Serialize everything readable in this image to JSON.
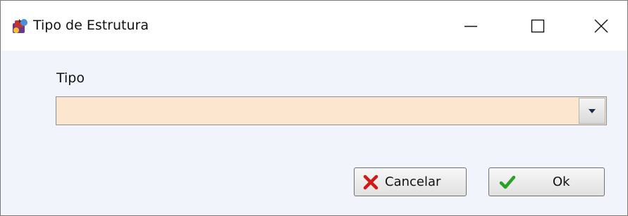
{
  "window": {
    "title": "Tipo de Estrutura",
    "app_icon": "application-icon",
    "controls": {
      "minimize_icon": "minimize-icon",
      "maximize_icon": "maximize-icon",
      "close_icon": "close-icon"
    }
  },
  "form": {
    "tipo_label": "Tipo",
    "tipo_value": "",
    "dropdown_icon": "chevron-down-icon",
    "field_color": "#fde6d0"
  },
  "buttons": {
    "cancel_label": "Cancelar",
    "cancel_icon": "x-icon",
    "cancel_icon_color": "#d01818",
    "ok_label": "Ok",
    "ok_icon": "checkmark-icon",
    "ok_icon_color": "#2aa02a"
  }
}
